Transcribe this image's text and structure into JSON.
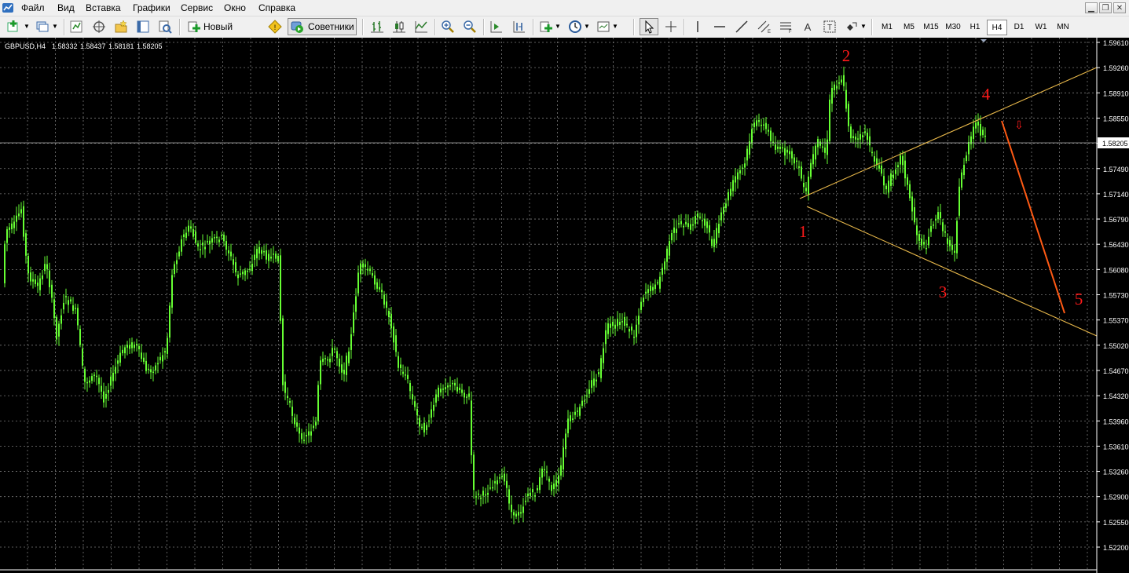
{
  "menu": {
    "items": [
      "Файл",
      "Вид",
      "Вставка",
      "Графики",
      "Сервис",
      "Окно",
      "Справка"
    ]
  },
  "toolbar": {
    "new_order_label": "Новый Ордер",
    "experts_label": "Советники",
    "timeframes": [
      "M1",
      "M5",
      "M15",
      "M30",
      "H1",
      "H4",
      "D1",
      "W1",
      "MN"
    ],
    "active_timeframe": "H4",
    "icons": [
      "new-chart-icon",
      "profiles-icon",
      "market-watch-icon",
      "navigator-icon",
      "favorites-icon",
      "data-window-icon",
      "tester-icon",
      "new-order-icon",
      "metaeditor-icon",
      "experts-icon",
      "bar-chart-icon",
      "candle-chart-icon",
      "line-chart-icon",
      "zoom-in-icon",
      "zoom-out-icon",
      "autoscroll-icon",
      "chart-shift-icon",
      "indicators-icon",
      "periods-icon",
      "templates-icon",
      "cursor-icon",
      "crosshair-icon",
      "vertical-line-icon",
      "horizontal-line-icon",
      "trendline-icon",
      "equidistant-channel-icon",
      "fibonacci-icon",
      "text-icon",
      "text-label-icon",
      "arrows-icon"
    ]
  },
  "chart": {
    "header": {
      "symbol": "GBPUSD,H4",
      "open": "1.58332",
      "high": "1.58437",
      "low": "1.58181",
      "close": "1.58205"
    },
    "current_price": "1.58205",
    "price_axis_labels": [
      "1.59610",
      "1.59260",
      "1.58910",
      "1.58550",
      "1.57850",
      "1.57490",
      "1.57140",
      "1.56790",
      "1.56430",
      "1.56080",
      "1.55730",
      "1.55370",
      "1.55020",
      "1.54670",
      "1.54320",
      "1.53960",
      "1.53610",
      "1.53260",
      "1.52900",
      "1.52550",
      "1.52200"
    ],
    "annotations": [
      "1",
      "2",
      "3",
      "4",
      "5"
    ],
    "sell_arrow": "⇩",
    "colors": {
      "background": "#000000",
      "candles": "#66ff33",
      "grid": "#7a7a7a",
      "trendlines": "#e8b84a",
      "forecast_line": "#ff5a14",
      "annotation_text": "#ff1a1a"
    }
  }
}
